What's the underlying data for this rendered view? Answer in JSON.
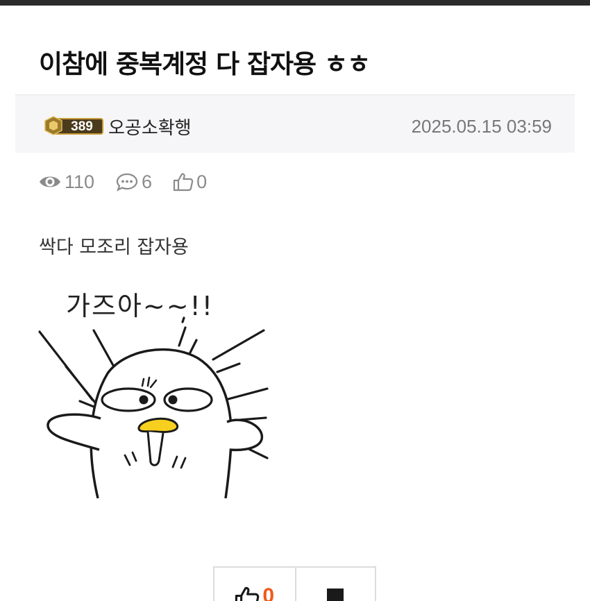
{
  "post": {
    "title": "이참에 중복계정 다 잡자용 ㅎㅎ",
    "author": {
      "level": "389",
      "name": "오공소확행"
    },
    "date": "2025.05.15 03:59",
    "stats": {
      "views": "110",
      "comments": "6",
      "likes": "0"
    },
    "body_text": "싹다 모조리 잡자용",
    "sticker": {
      "caption": "가즈아~~!!",
      "icon": "duck-sticker"
    }
  },
  "actions": {
    "like_count": "0",
    "icons": [
      "thumbs-up-icon",
      "bookmark-icon"
    ]
  },
  "colors": {
    "topbar": "#2b2b2b",
    "accent": "#f05a1a",
    "stat_gray": "#8a8a8a",
    "author_bar_bg": "#f6f6f8"
  }
}
